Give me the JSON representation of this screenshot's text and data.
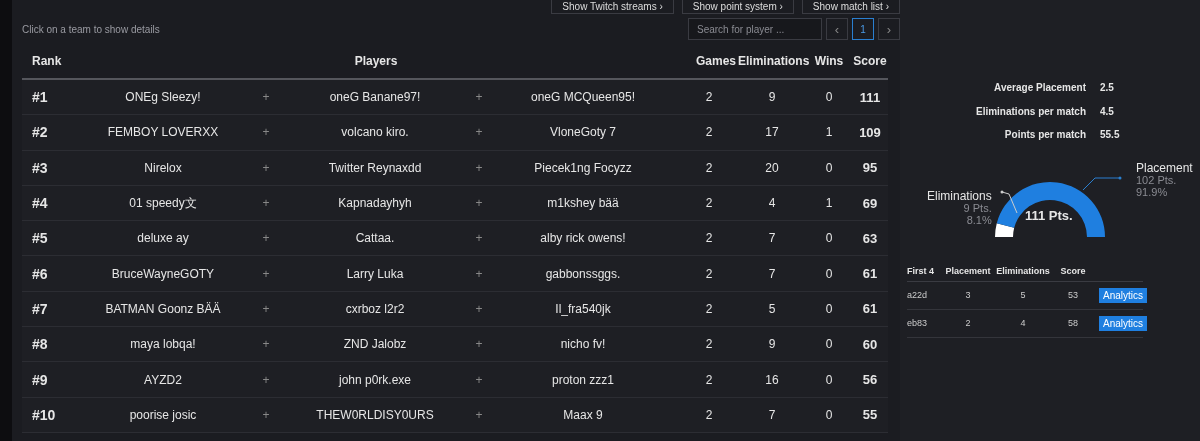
{
  "top_buttons": [
    {
      "label": "Show Twitch streams",
      "icon": "›"
    },
    {
      "label": "Show point system",
      "icon": "›"
    },
    {
      "label": "Show match list",
      "icon": "›"
    }
  ],
  "hint": "Click on a team to show details",
  "search": {
    "placeholder": "Search for player ..."
  },
  "pagination": {
    "prev": "‹",
    "next": "›",
    "pages": [
      {
        "label": "1",
        "selected": true
      }
    ]
  },
  "table": {
    "columns": {
      "rank": "Rank",
      "players": "Players",
      "games": "Games",
      "eliminations": "Eliminations",
      "wins": "Wins",
      "score": "Score"
    },
    "rows": [
      {
        "rank": "#1",
        "players": [
          "ONEg Sleezy!",
          "oneG Banane97!",
          "oneG MCQueen95!"
        ],
        "joiner": "+",
        "games": "2",
        "eliminations": "9",
        "wins": "0",
        "score": "111"
      },
      {
        "rank": "#2",
        "players": [
          "FEMBOY LOVERXX",
          "volcano kiro.",
          "VloneGoty 7"
        ],
        "joiner": "+",
        "games": "2",
        "eliminations": "17",
        "wins": "1",
        "score": "109"
      },
      {
        "rank": "#3",
        "players": [
          "Nirelox",
          "Twitter Reynaxdd",
          "Piecek1ng Focyzz"
        ],
        "joiner": "+",
        "games": "2",
        "eliminations": "20",
        "wins": "0",
        "score": "95"
      },
      {
        "rank": "#4",
        "players": [
          "01 speedy文",
          "Kapnadayhyh",
          "m1kshey bää"
        ],
        "joiner": "+",
        "games": "2",
        "eliminations": "4",
        "wins": "1",
        "score": "69"
      },
      {
        "rank": "#5",
        "players": [
          "deluxe ay",
          "Cattaa.",
          "alby rick owens!"
        ],
        "joiner": "+",
        "games": "2",
        "eliminations": "7",
        "wins": "0",
        "score": "63"
      },
      {
        "rank": "#6",
        "players": [
          "BruceWayneGOTY",
          "Larry Luka",
          "gabbonssggs."
        ],
        "joiner": "+",
        "games": "2",
        "eliminations": "7",
        "wins": "0",
        "score": "61"
      },
      {
        "rank": "#7",
        "players": [
          "BATMAN Goonz BÄÄ",
          "cxrboz l2r2",
          "Il_fra540jk"
        ],
        "joiner": "+",
        "games": "2",
        "eliminations": "5",
        "wins": "0",
        "score": "61"
      },
      {
        "rank": "#8",
        "players": [
          "maya lobqa!",
          "ZND Jalobz",
          "nicho fv!"
        ],
        "joiner": "+",
        "games": "2",
        "eliminations": "9",
        "wins": "0",
        "score": "60"
      },
      {
        "rank": "#9",
        "players": [
          "AYZD2",
          "john p0rk.exe",
          "proton zzz1"
        ],
        "joiner": "+",
        "games": "2",
        "eliminations": "16",
        "wins": "0",
        "score": "56"
      },
      {
        "rank": "#10",
        "players": [
          "poorise josic",
          "THEW0RLDISY0URS",
          "Maax 9"
        ],
        "joiner": "+",
        "games": "2",
        "eliminations": "7",
        "wins": "0",
        "score": "55"
      }
    ]
  },
  "details": {
    "stats": [
      {
        "label": "Average Placement",
        "value": "2.5"
      },
      {
        "label": "Eliminations per match",
        "value": "4.5"
      },
      {
        "label": "Points per match",
        "value": "55.5"
      }
    ],
    "gauge": {
      "total": "111 Pts.",
      "segments": [
        {
          "points": "9 Pts.",
          "percent": "8.1%",
          "color": "#ffffff"
        },
        {
          "points": "102 Pts.",
          "percent": "91.9%",
          "color": "#1f7fe0"
        }
      ],
      "chart_data": {
        "type": "donut",
        "categories": [
          "Eliminations",
          "Placement"
        ],
        "values": [
          8.1,
          91.9
        ]
      }
    },
    "matches": {
      "columns": [
        "First 4",
        "Placement",
        "Eliminations",
        "Score"
      ],
      "rows": [
        {
          "id": "a22d",
          "placement": "3",
          "eliminations": "5",
          "score": "53",
          "button": "Analytics"
        },
        {
          "id": "eb83",
          "placement": "2",
          "eliminations": "4",
          "score": "58",
          "button": "Analytics"
        }
      ]
    }
  }
}
